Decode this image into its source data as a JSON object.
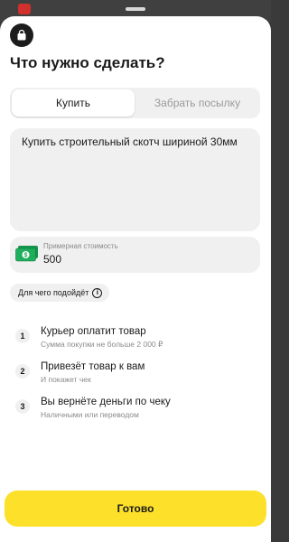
{
  "sheet": {
    "title": "Что нужно сделать?"
  },
  "tabs": [
    {
      "label": "Купить",
      "active": true
    },
    {
      "label": "Забрать посылку",
      "active": false
    }
  ],
  "task": {
    "value": "Купить строительный скотч шириной 30мм"
  },
  "price": {
    "label": "Примерная стоимость",
    "value": "500"
  },
  "info_pill": {
    "label": "Для чего подойдёт"
  },
  "steps": [
    {
      "number": "1",
      "title": "Курьер оплатит товар",
      "subtitle": "Сумма покупки не больше 2 000 ₽"
    },
    {
      "number": "2",
      "title": "Привезёт товар к вам",
      "subtitle": "И покажет чек"
    },
    {
      "number": "3",
      "title": "Вы вернёте деньги по чеку",
      "subtitle": "Наличными или переводом"
    }
  ],
  "done_button": {
    "label": "Готово"
  },
  "colors": {
    "accent": "#fde02a",
    "money_icon": "#1fae5b"
  },
  "icons": [
    "shopping-bag-icon",
    "money-icon",
    "info-icon"
  ]
}
